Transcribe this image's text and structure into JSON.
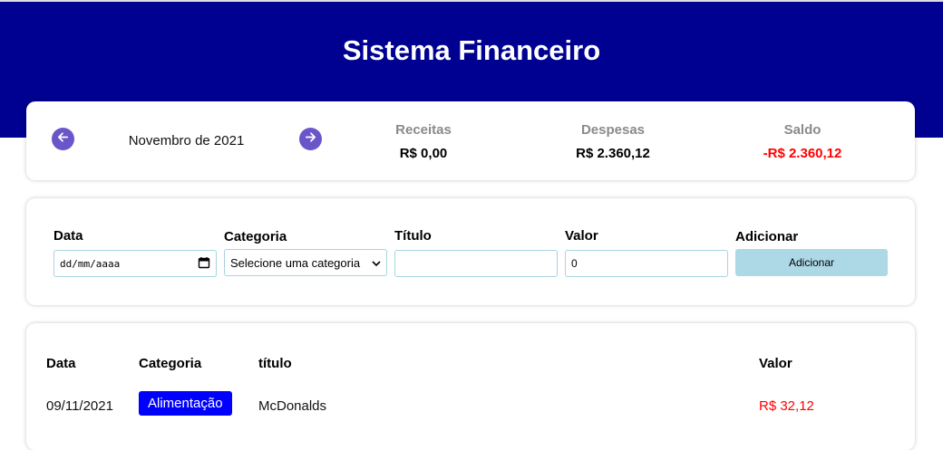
{
  "app": {
    "title": "Sistema Financeiro"
  },
  "colors": {
    "header": "#000091",
    "nav_button": "#6a56c9",
    "negative": "#ff0000",
    "category_badge": "#0000ff",
    "add_button": "#add8e6"
  },
  "period": {
    "label": "Novembro de 2021",
    "prev_icon": "arrow-left-icon",
    "next_icon": "arrow-right-icon"
  },
  "summary": {
    "receitas": {
      "label": "Receitas",
      "value": "R$ 0,00"
    },
    "despesas": {
      "label": "Despesas",
      "value": "R$ 2.360,12"
    },
    "saldo": {
      "label": "Saldo",
      "value": "-R$ 2.360,12"
    }
  },
  "form": {
    "data": {
      "label": "Data",
      "placeholder": "dd/mm/aaaa"
    },
    "categoria": {
      "label": "Categoria",
      "selected": "Selecione uma categoria"
    },
    "titulo": {
      "label": "Título",
      "value": ""
    },
    "valor": {
      "label": "Valor",
      "value": "0"
    },
    "adicionar": {
      "label": "Adicionar",
      "button_label": "Adicionar"
    }
  },
  "table": {
    "headers": {
      "data": "Data",
      "categoria": "Categoria",
      "titulo": "título",
      "valor": "Valor"
    },
    "rows": [
      {
        "data": "09/11/2021",
        "categoria": "Alimentação",
        "titulo": "McDonalds",
        "valor": "R$ 32,12"
      }
    ]
  }
}
